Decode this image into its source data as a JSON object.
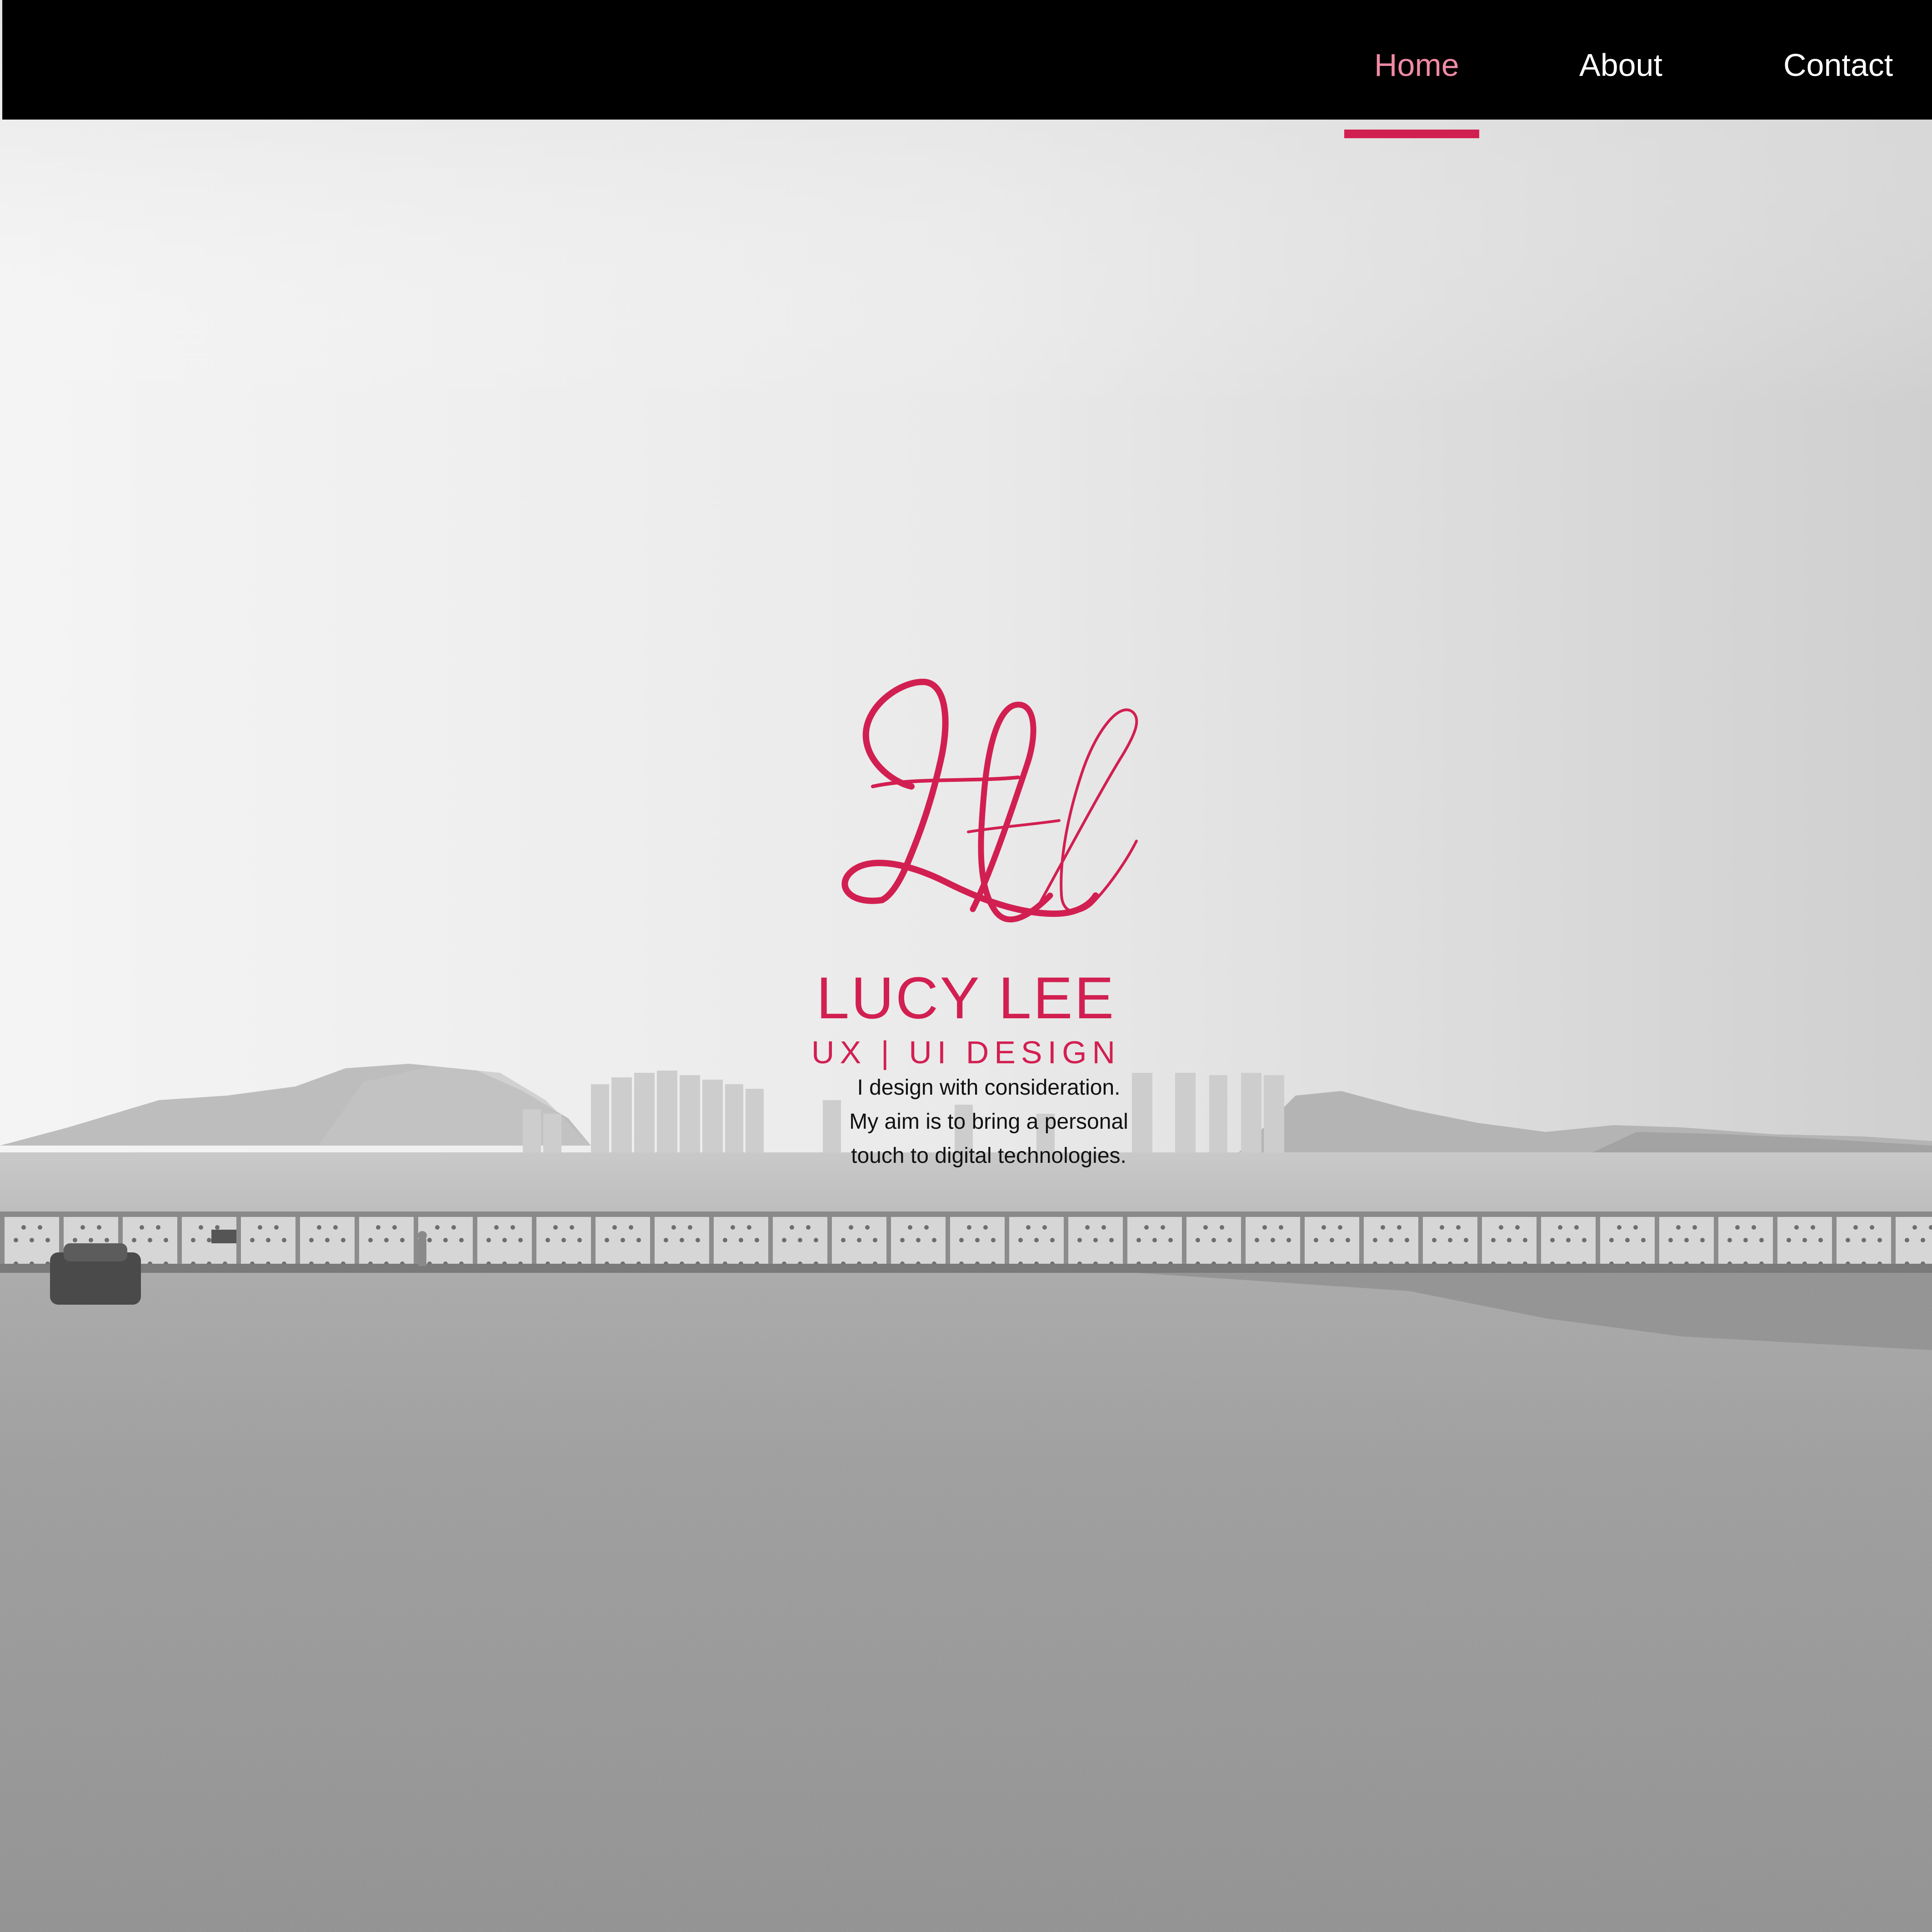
{
  "nav": {
    "items": [
      {
        "label": "Home",
        "active": true
      },
      {
        "label": "About",
        "active": false
      },
      {
        "label": "Contact",
        "active": false
      }
    ],
    "active_color": "#f08aa4",
    "indicator_color": "#d21f51",
    "background": "#000000"
  },
  "hero": {
    "logo_icon": "ll-monogram-icon",
    "brand_name": "LUCY LEE",
    "brand_sub": "UX | UI DESIGN",
    "tagline_lines": [
      "I design with consideration.",
      "My aim is to bring a personal",
      "touch to digital technologies."
    ],
    "accent_color": "#d21f51"
  },
  "background": {
    "description_icon": "seaside-landscape-photo"
  }
}
